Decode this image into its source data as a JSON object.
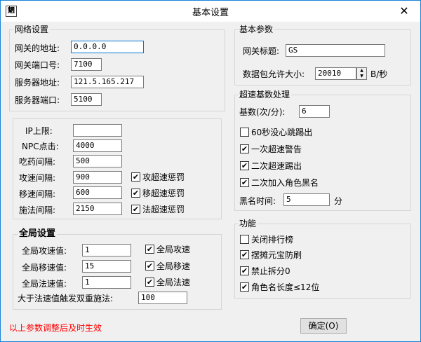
{
  "window": {
    "title": "基本设置",
    "icon_char": "魍",
    "close_symbol": "✕"
  },
  "network": {
    "legend": "网络设置",
    "gateway_address_label": "网关的地址:",
    "gateway_address_value": "0.0.0.0",
    "gateway_port_label": "网关端口号:",
    "gateway_port_value": "7100",
    "server_address_label": "服务器地址:",
    "server_address_value": "121.5.165.217",
    "server_port_label": "服务器端口:",
    "server_port_value": "5100"
  },
  "limits": {
    "ip_limit_label": "IP上限:",
    "ip_limit_value": "",
    "npc_click_label": "NPC点击:",
    "npc_click_value": "4000",
    "potion_interval_label": "吃药间隔:",
    "potion_interval_value": "500",
    "attack_interval_label": "攻速间隔:",
    "attack_interval_value": "900",
    "attack_penalty_label": "攻超速惩罚",
    "attack_penalty_checked": true,
    "move_interval_label": "移速间隔:",
    "move_interval_value": "600",
    "move_penalty_label": "移超速惩罚",
    "move_penalty_checked": true,
    "spell_interval_label": "施法间隔:",
    "spell_interval_value": "2150",
    "spell_penalty_label": "法超速惩罚",
    "spell_penalty_checked": true
  },
  "global": {
    "legend": "全局设置",
    "attack_value_label": "全局攻速值:",
    "attack_value": "1",
    "attack_check_label": "全局攻速",
    "attack_checked": true,
    "move_value_label": "全局移速值:",
    "move_value": "15",
    "move_check_label": "全局移速",
    "move_checked": true,
    "spell_value_label": "全局法速值:",
    "spell_value": "1",
    "spell_check_label": "全局法速",
    "spell_checked": true,
    "double_cast_label": "大于法速值触发双重施法:",
    "double_cast_value": "100"
  },
  "basic": {
    "legend": "基本参数",
    "gateway_title_label": "网关标题:",
    "gateway_title_value": "GS",
    "packet_limit_label": "数据包允许大小:",
    "packet_limit_value": "20010",
    "packet_unit": "B/秒"
  },
  "overspeed": {
    "legend": "超速基数处理",
    "base_label": "基数(次/分):",
    "base_value": "6",
    "no_heartbeat_label": "60秒没心跳踢出",
    "no_heartbeat_checked": false,
    "first_warning_label": "一次超速警告",
    "first_warning_checked": true,
    "second_kick_label": "二次超速踢出",
    "second_kick_checked": true,
    "second_blacklist_label": "二次加入角色黑名",
    "second_blacklist_checked": true,
    "blacklist_time_label": "黑名时间:",
    "blacklist_time_value": "5",
    "blacklist_time_unit": "分"
  },
  "features": {
    "legend": "功能",
    "close_ranking_label": "关闭排行榜",
    "close_ranking_checked": false,
    "stall_protect_label": "摆摊元宝防刷",
    "stall_protect_checked": true,
    "no_split_label": "禁止拆分0",
    "no_split_checked": true,
    "name_length_label": "角色名长度≤12位",
    "name_length_checked": true
  },
  "footer": {
    "note": "以上参数调整后及时生效",
    "note_color": "#ff0000",
    "ok_label": "确定(O)"
  },
  "check_mark": "✔"
}
